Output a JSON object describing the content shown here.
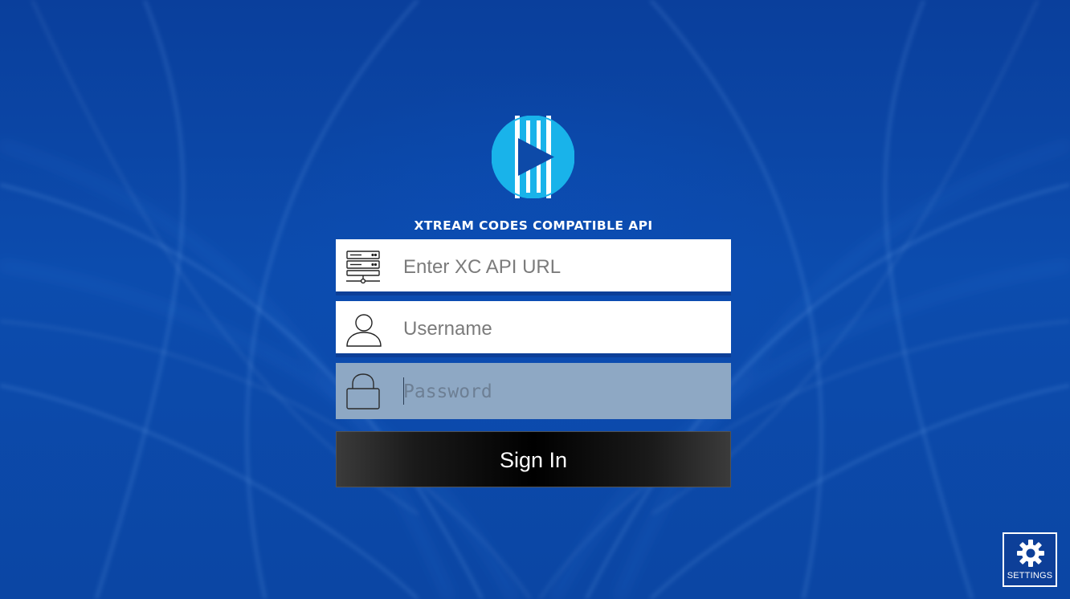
{
  "app": {
    "heading": "XTREAM CODES COMPATIBLE API"
  },
  "form": {
    "url_placeholder": "Enter XC API URL",
    "username_placeholder": "Username",
    "password_placeholder": "Password",
    "signin_label": "Sign In"
  },
  "icons": {
    "logo": "play-logo-icon",
    "url": "server-icon",
    "username": "user-icon",
    "password": "lock-icon",
    "settings": "gear-icon"
  },
  "settings": {
    "label": "SETTINGS"
  },
  "colors": {
    "background": "#0d4aa8",
    "logo_accent": "#19b3ea",
    "password_field": "#8ea8c4",
    "signin_button": "#000000"
  }
}
